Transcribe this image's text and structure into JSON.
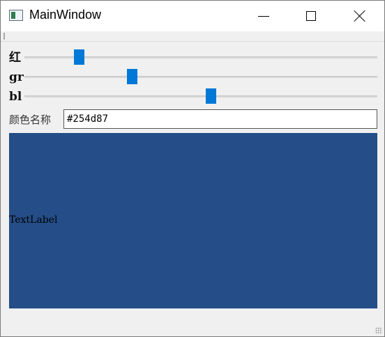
{
  "window": {
    "title": "MainWindow",
    "icon": "app-window-icon"
  },
  "sliders": [
    {
      "label": "红",
      "value_fraction": 0.145,
      "color": "#0078d7"
    },
    {
      "label": "gr",
      "value_fraction": 0.3,
      "color": "#0078d7"
    },
    {
      "label": "bl",
      "value_fraction": 0.53,
      "color": "#0078d7"
    }
  ],
  "color_name": {
    "label": "颜色名称",
    "value": "#254d87"
  },
  "preview": {
    "text": "TextLabel",
    "background": "#254d87"
  }
}
